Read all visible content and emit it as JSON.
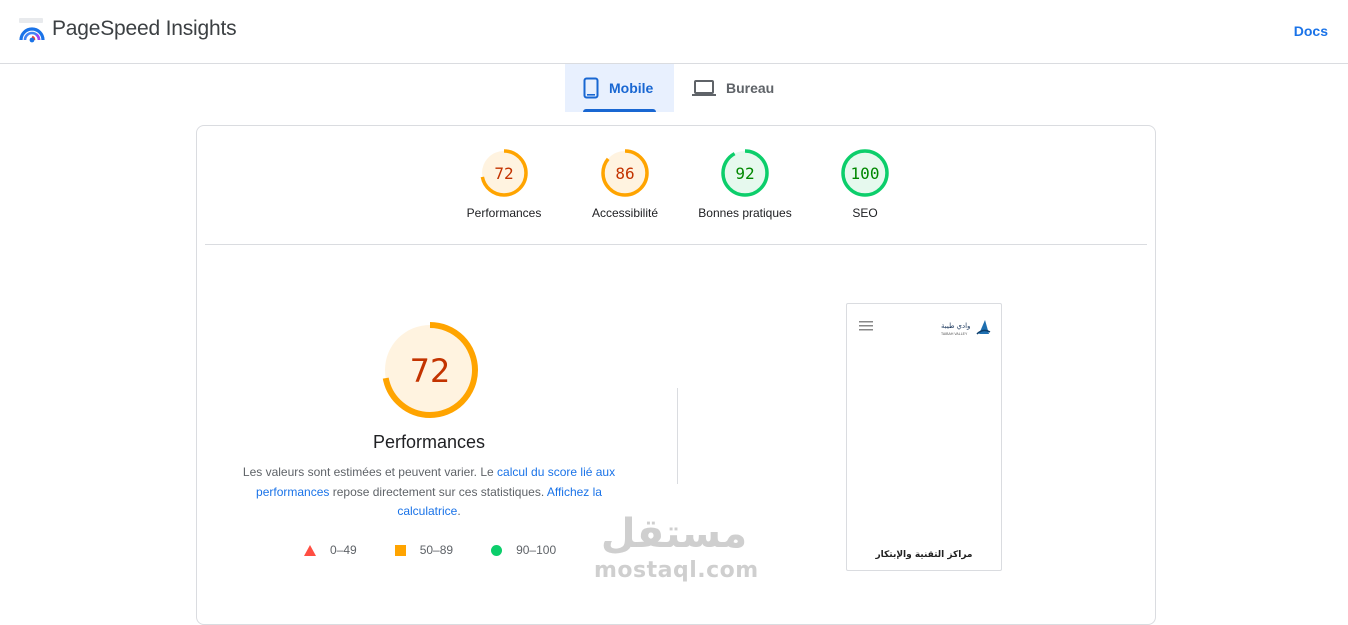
{
  "header": {
    "app_title": "PageSpeed Insights",
    "docs_label": "Docs"
  },
  "tabs": [
    {
      "label": "Mobile",
      "icon": "smartphone-icon",
      "active": true
    },
    {
      "label": "Bureau",
      "icon": "laptop-icon",
      "active": false
    }
  ],
  "scores": [
    {
      "label": "Performances",
      "value": "72",
      "score": 72,
      "status": "average"
    },
    {
      "label": "Accessibilité",
      "value": "86",
      "score": 86,
      "status": "average"
    },
    {
      "label": "Bonnes pratiques",
      "value": "92",
      "score": 92,
      "status": "good"
    },
    {
      "label": "SEO",
      "value": "100",
      "score": 100,
      "status": "good"
    }
  ],
  "main_score": {
    "value": "72",
    "score": 72,
    "title": "Performances",
    "desc_text_1": "Les valeurs sont estimées et peuvent varier. Le ",
    "desc_link_1": "calcul du score lié aux performances",
    "desc_text_2": " repose directement sur ces statistiques. ",
    "desc_link_2": "Affichez la calculatrice",
    "desc_text_3": "."
  },
  "legend": [
    {
      "range": "0–49",
      "shape": "triangle",
      "color": "#ff4e42"
    },
    {
      "range": "50–89",
      "shape": "square",
      "color": "#ffa400"
    },
    {
      "range": "90–100",
      "shape": "circle",
      "color": "#0cce6b"
    }
  ],
  "screenshot": {
    "caption": "مراكز التقنية والإبتكار",
    "logo_text": "وادي طيبة",
    "logo_subtext": "TAIBAH VALLEY"
  },
  "watermark": {
    "arabic": "مستقل",
    "latin": "mostaql.com"
  },
  "colors": {
    "accent": "#1a73e8",
    "average_stroke": "#ffa400",
    "average_fill": "#fff3e0",
    "average_text": "#c33300",
    "good_stroke": "#0cce6b",
    "good_fill": "#e6f9ee",
    "good_text": "#008800"
  }
}
